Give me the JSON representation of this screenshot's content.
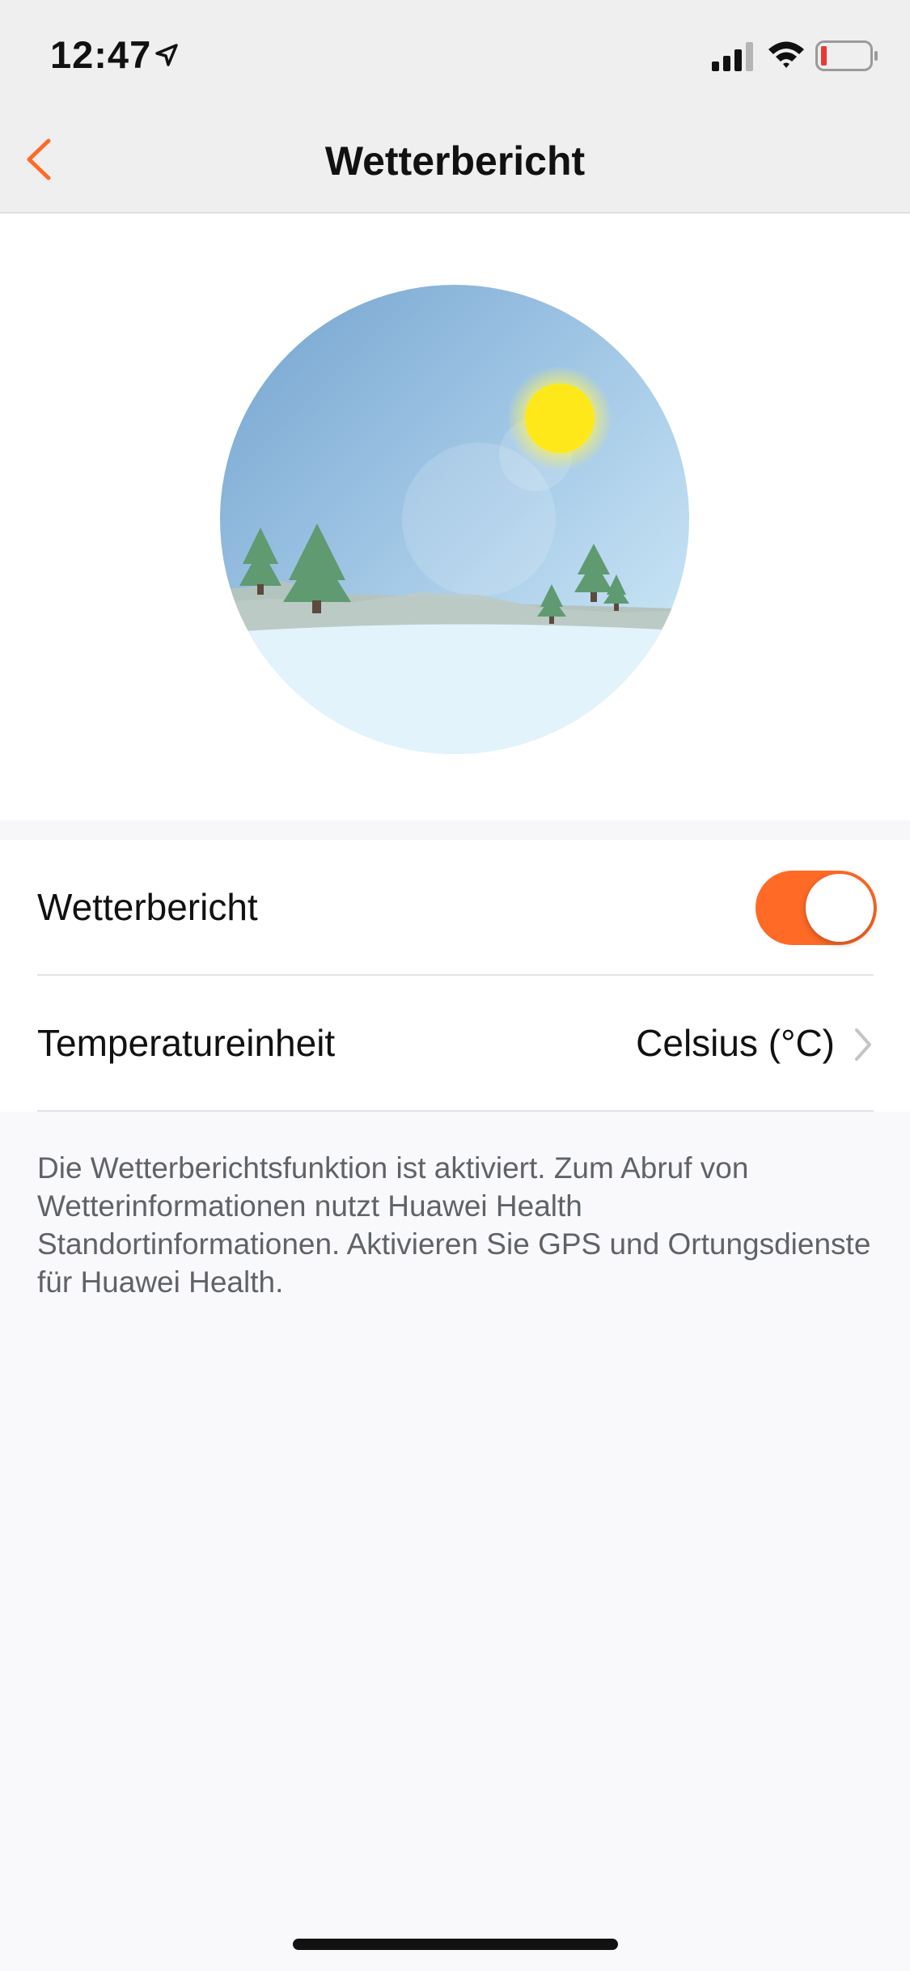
{
  "status_bar": {
    "time": "12:47",
    "icons": [
      "location-arrow-icon",
      "signal-icon",
      "wifi-icon",
      "battery-low-icon"
    ],
    "battery_color": "#e53935"
  },
  "nav": {
    "title": "Wetterbericht",
    "back_icon": "chevron-left-icon",
    "accent_color": "#ff6a26"
  },
  "hero": {
    "illustration": "winter-landscape-illustration"
  },
  "settings": {
    "weather_report": {
      "label": "Wetterbericht",
      "enabled": true
    },
    "temperature_unit": {
      "label": "Temperatureinheit",
      "value": "Celsius (°C)"
    }
  },
  "info": {
    "text": "Die Wetterberichtsfunktion ist aktiviert. Zum Abruf von Wetterinformationen nutzt Huawei Health Standortinformationen. Aktivieren Sie GPS und Ortungsdienste für Huawei Health."
  }
}
